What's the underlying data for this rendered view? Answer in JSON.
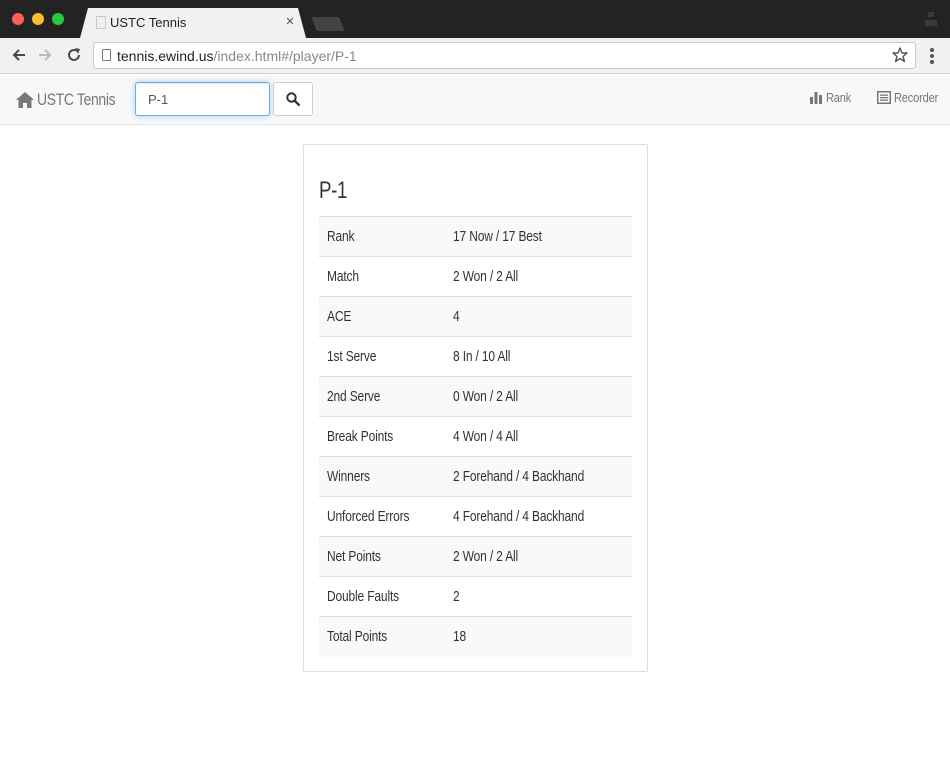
{
  "browser": {
    "tab_title": "USTC Tennis",
    "tab_close": "×",
    "url_host": "tennis.ewind.us",
    "url_path": "/index.html#/player/P-1"
  },
  "navbar": {
    "brand": "USTC Tennis",
    "search_value": "P-1",
    "rank_label": "Rank",
    "recorder_label": "Recorder"
  },
  "player": {
    "name": "P-1",
    "stats": [
      {
        "label": "Rank",
        "value": "17 Now / 17 Best"
      },
      {
        "label": "Match",
        "value": "2 Won / 2 All"
      },
      {
        "label": "ACE",
        "value": "4"
      },
      {
        "label": "1st Serve",
        "value": "8 In / 10 All"
      },
      {
        "label": "2nd Serve",
        "value": "0 Won / 2 All"
      },
      {
        "label": "Break Points",
        "value": "4 Won / 4 All"
      },
      {
        "label": "Winners",
        "value": "2 Forehand / 4 Backhand"
      },
      {
        "label": "Unforced Errors",
        "value": "4 Forehand / 4 Backhand"
      },
      {
        "label": "Net Points",
        "value": "2 Won / 2 All"
      },
      {
        "label": "Double Faults",
        "value": "2"
      },
      {
        "label": "Total Points",
        "value": "18"
      }
    ]
  },
  "colors": {
    "navbar_bg": "#f8f8f8",
    "navbar_text": "#777777",
    "focus_border": "#66afe9",
    "table_stripe": "#f9f9f9",
    "chrome_dark": "#232323"
  }
}
